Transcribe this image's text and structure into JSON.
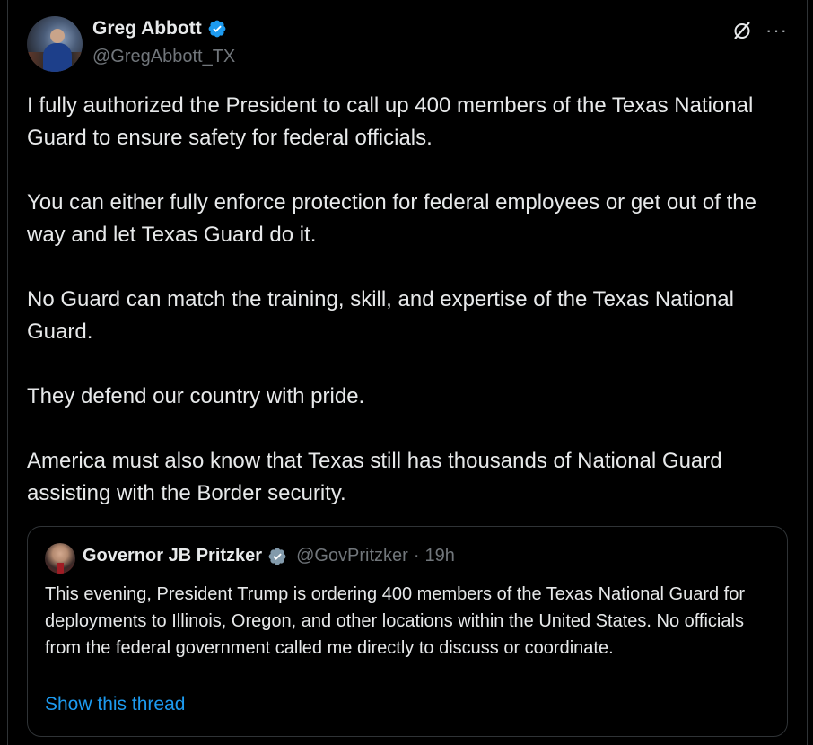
{
  "author": {
    "display_name": "Greg Abbott",
    "handle": "@GregAbbott_TX"
  },
  "icons": {
    "verified": "verified-badge-icon",
    "grok": "grok-icon",
    "more": "more-options-icon"
  },
  "colors": {
    "background": "#000000",
    "text_primary": "#e7e9ea",
    "text_secondary": "#71767b",
    "verified": "#1d9bf0",
    "link": "#1d9bf0",
    "border": "#2f3336"
  },
  "tweet": {
    "paragraphs": [
      "I fully authorized the President to call up 400 members of the Texas National Guard to ensure safety for federal officials.",
      "You can either fully enforce protection for federal employees or get out of the way and let Texas Guard do it.",
      "No Guard can match the training, skill, and expertise of the Texas National Guard.",
      "They defend our country with pride.",
      "America must also know that Texas still has thousands of National Guard assisting with the Border security."
    ]
  },
  "quote": {
    "display_name": "Governor JB Pritzker",
    "handle": "@GovPritzker",
    "separator": "·",
    "time": "19h",
    "text": "This evening, President Trump is ordering 400 members of the Texas National Guard for deployments to Illinois, Oregon, and other locations within the United States. No officials from the federal government called me directly to discuss or coordinate.",
    "show_thread": "Show this thread"
  },
  "more_glyph": "···"
}
